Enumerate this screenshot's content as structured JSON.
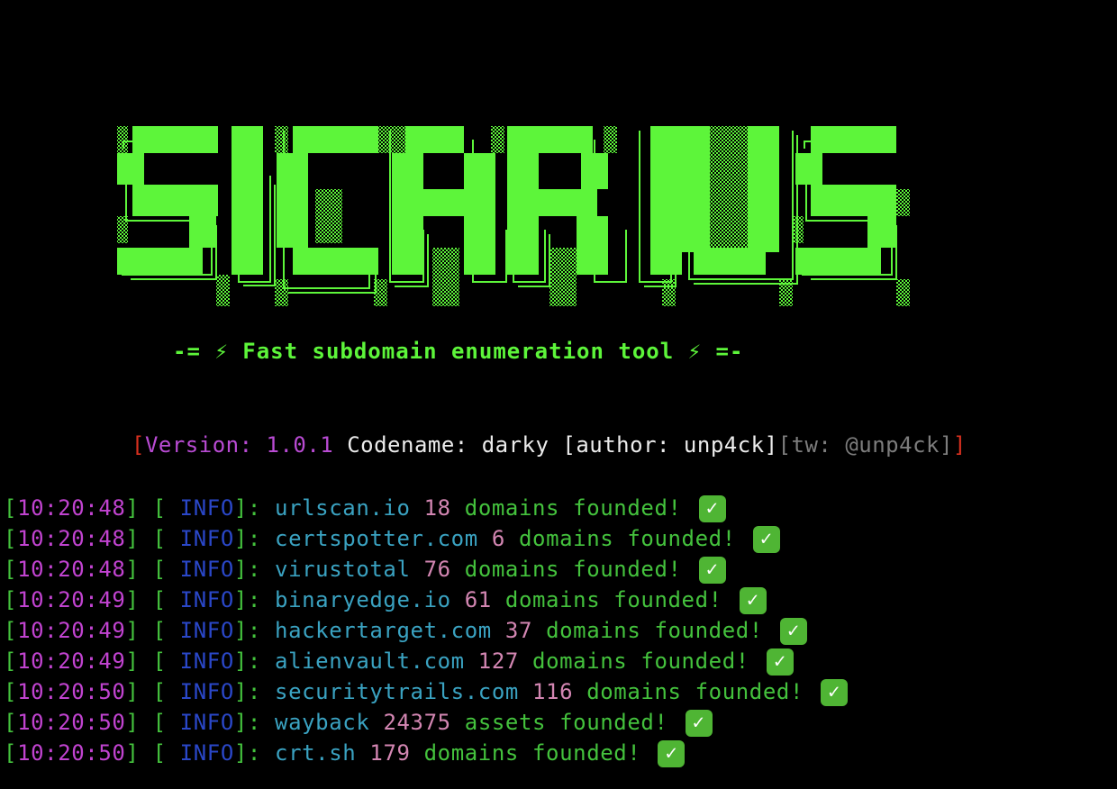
{
  "banner": {
    "logo_text": "SICARIUS",
    "tagline": "-= ⚡ Fast subdomain enumeration tool ⚡ =-",
    "color": "#5df53a"
  },
  "version_line": {
    "open_bracket": "[",
    "version": "Version: 1.0.1",
    "codename": " Codename: darky [author: unp4ck]",
    "twitter": "[tw: @unp4ck]",
    "close_bracket": "]"
  },
  "log": {
    "level": "INFO",
    "check_icon": "check-mark-icon",
    "entries": [
      {
        "time": "10:20:48",
        "source": "urlscan.io",
        "count": "18",
        "message": "domains founded!"
      },
      {
        "time": "10:20:48",
        "source": "certspotter.com",
        "count": "6",
        "message": "domains founded!"
      },
      {
        "time": "10:20:48",
        "source": "virustotal",
        "count": "76",
        "message": "domains founded!"
      },
      {
        "time": "10:20:49",
        "source": "binaryedge.io",
        "count": "61",
        "message": "domains founded!"
      },
      {
        "time": "10:20:49",
        "source": "hackertarget.com",
        "count": "37",
        "message": "domains founded!"
      },
      {
        "time": "10:20:49",
        "source": "alienvault.com",
        "count": "127",
        "message": "domains founded!"
      },
      {
        "time": "10:20:50",
        "source": "securitytrails.com",
        "count": "116",
        "message": "domains founded!"
      },
      {
        "time": "10:20:50",
        "source": "wayback",
        "count": "24375",
        "message": "assets founded!"
      },
      {
        "time": "10:20:50",
        "source": "crt.sh",
        "count": "179",
        "message": "domains founded!"
      }
    ]
  }
}
